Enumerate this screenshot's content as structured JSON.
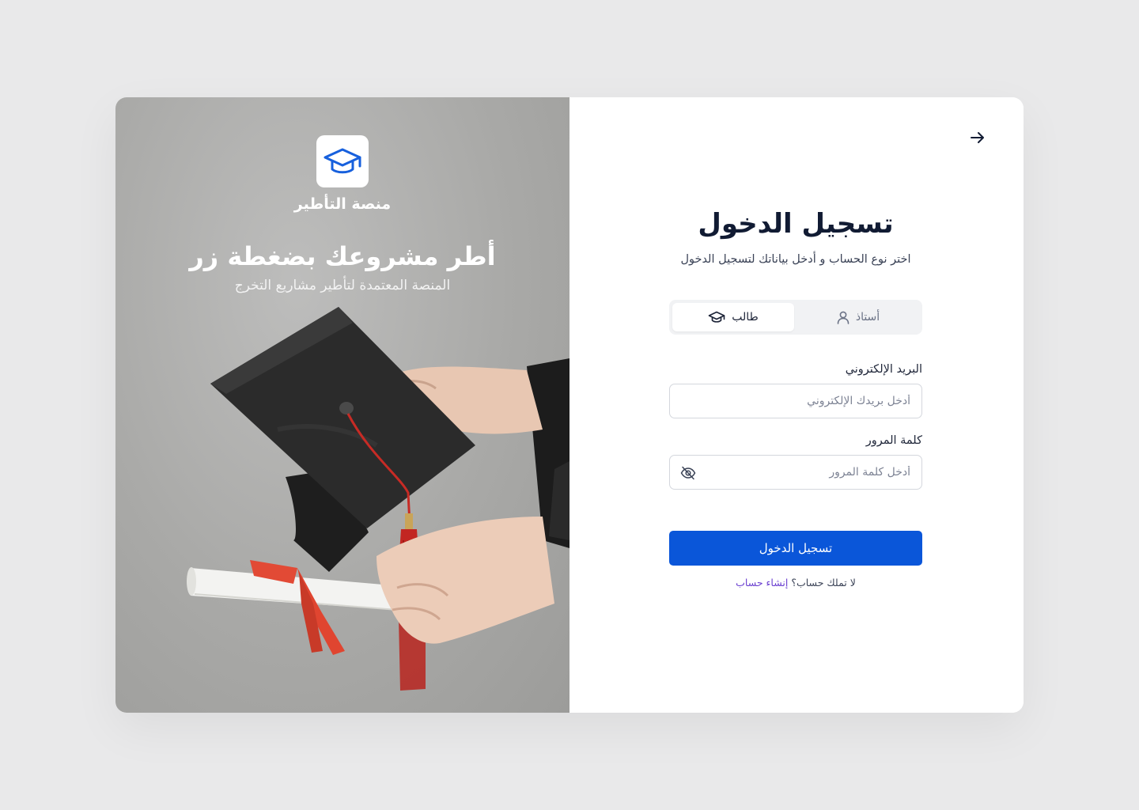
{
  "hero": {
    "brand_name": "منصة التأطير",
    "headline": "أطر مشروعك بضغطة زر",
    "subtitle": "المنصة المعتمدة لتأطير مشاريع التخرج"
  },
  "login": {
    "title": "تسجيل الدخول",
    "subtitle": "اختر نوع الحساب و أدخل بياناتك لتسجيل الدخول",
    "account_types": [
      {
        "label": "طالب",
        "icon": "graduation-cap-icon",
        "selected": true
      },
      {
        "label": "أستاذ",
        "icon": "user-icon",
        "selected": false
      }
    ],
    "email": {
      "label": "البريد الإلكتروني",
      "placeholder": "أدخل بريدك الإلكتروني",
      "value": ""
    },
    "password": {
      "label": "كلمة المرور",
      "placeholder": "أدخل كلمة المرور",
      "value": ""
    },
    "submit_label": "تسجيل الدخول",
    "no_account_text": "لا تملك حساب؟",
    "signup_link": "إنشاء حساب"
  },
  "colors": {
    "primary": "#0a56d9",
    "link": "#6a3fd0",
    "title": "#111b33",
    "page_bg": "#e9e9ea"
  }
}
